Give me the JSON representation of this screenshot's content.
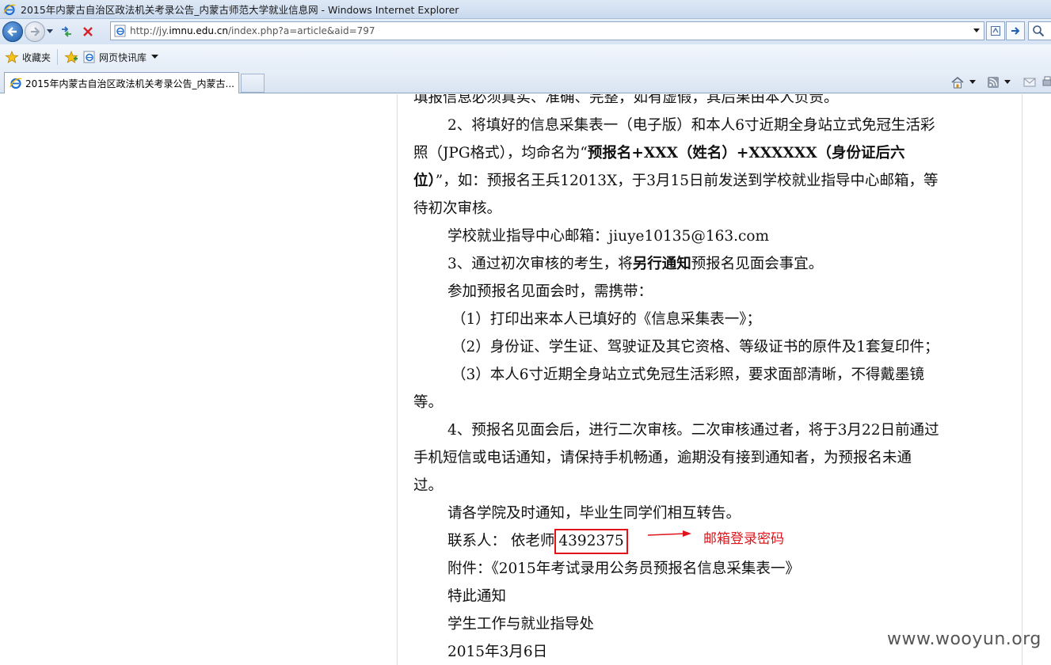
{
  "window": {
    "title": "2015年内蒙古自治区政法机关考录公告_内蒙古师范大学就业信息网 - Windows Internet Explorer"
  },
  "address_bar": {
    "url_prefix": "http://jy.",
    "url_domain": "imnu.edu.cn",
    "url_path": "/index.php?a=article&aid=797"
  },
  "favorites_bar": {
    "favorites_label": "收藏夹",
    "web_slice_label": "网页快讯库"
  },
  "tabs": [
    {
      "label": "2015年内蒙古自治区政法机关考录公告_内蒙古..."
    }
  ],
  "article": {
    "lines": {
      "l0": "填报信息必须真实、准确、完整，如有虚假，其后果由本人负责。",
      "l1": "2、将填好的信息采集表一（电子版）和本人6寸近期全身站立式免冠生活彩",
      "l2a": "照（JPG格式），均命名为“",
      "l2b": "预报名+XXX（姓名）+XXXXXX（身份证后六",
      "l3a": "位）",
      "l3b": "”，如：预报名王兵12013X，于3月15日前发送到学校就业指导中心邮箱，等",
      "l4": "待初次审核。",
      "l5": "学校就业指导中心邮箱：jiuye10135@163.com",
      "l6a": "3、通过初次审核的考生，将",
      "l6b": "另行通知",
      "l6c": "预报名见面会事宜。",
      "l7": "参加预报名见面会时，需携带：",
      "l8": "（1）打印出来本人已填好的《信息采集表一》；",
      "l9": "（2）身份证、学生证、驾驶证及其它资格、等级证书的原件及1套复印件；",
      "l10": "（3）本人6寸近期全身站立式免冠生活彩照，要求面部清晰，不得戴墨镜",
      "l11": "等。",
      "l12": "4、预报名见面会后，进行二次审核。二次审核通过者，将于3月22日前通过",
      "l13": "手机短信或电话通知，请保持手机畅通，逾期没有接到通知者，为预报名未通",
      "l14": "过。",
      "l15": "请各学院及时通知，毕业生同学们相互转告。",
      "l16a": "联系人：  依老师",
      "l16b": "4392375",
      "l17": "附件：《2015年考试录用公务员预报名信息采集表一》",
      "l18": "特此通知",
      "l19": "学生工作与就业指导处",
      "l20": "2015年3月6日"
    }
  },
  "annotation": {
    "text": "邮箱登录密码",
    "color": "#e0141a"
  },
  "watermark": "www.wooyun.org"
}
